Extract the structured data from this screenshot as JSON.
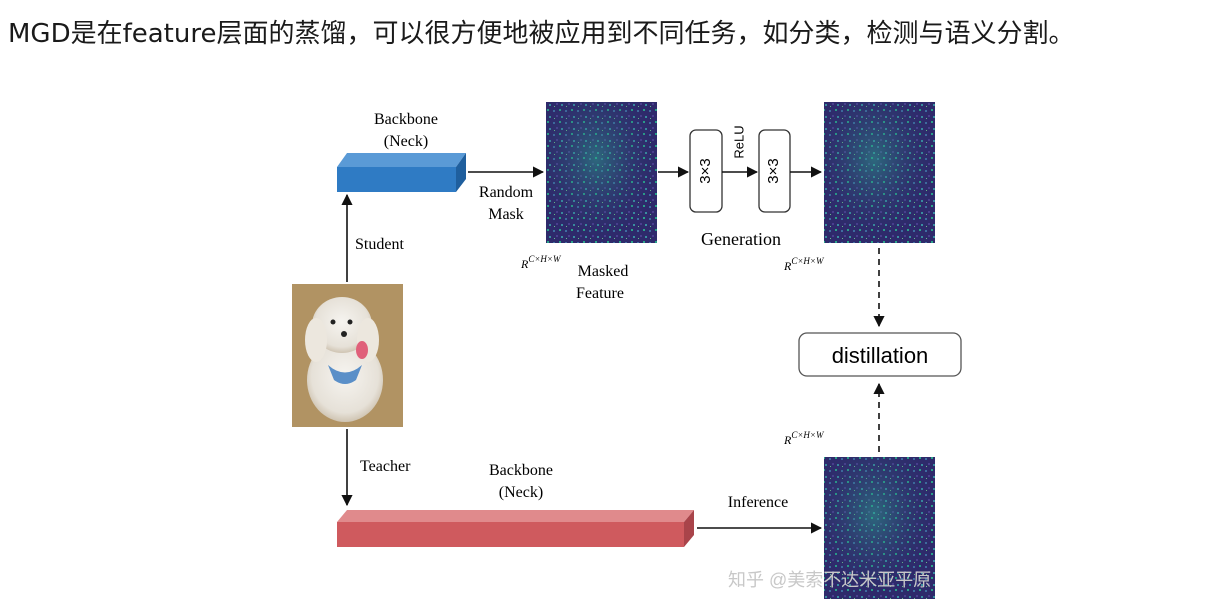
{
  "intro_text": "MGD是在feature层面的蒸馏，可以很方便地被应用到不同任务，如分类，检测与语义分割。",
  "diagram": {
    "student_backbone": [
      "Backbone",
      "(Neck)"
    ],
    "teacher_backbone": [
      "Backbone",
      "(Neck)"
    ],
    "student_label": "Student",
    "teacher_label": "Teacher",
    "random_mask": [
      "Random",
      "Mask"
    ],
    "masked_feature": [
      "Masked",
      "Feature"
    ],
    "dim_label": "R",
    "dim_sup": "C×H×W",
    "conv1": "3×3",
    "relu": "ReLU",
    "conv2": "3×3",
    "generation": "Generation",
    "distillation": "distillation",
    "inference": "Inference"
  },
  "watermark": "知乎 @美索不达米亚平原",
  "colors": {
    "student_block": "#2f7bc4",
    "teacher_block": "#cf5a5e",
    "feature_bg": "#2e2a6b"
  }
}
